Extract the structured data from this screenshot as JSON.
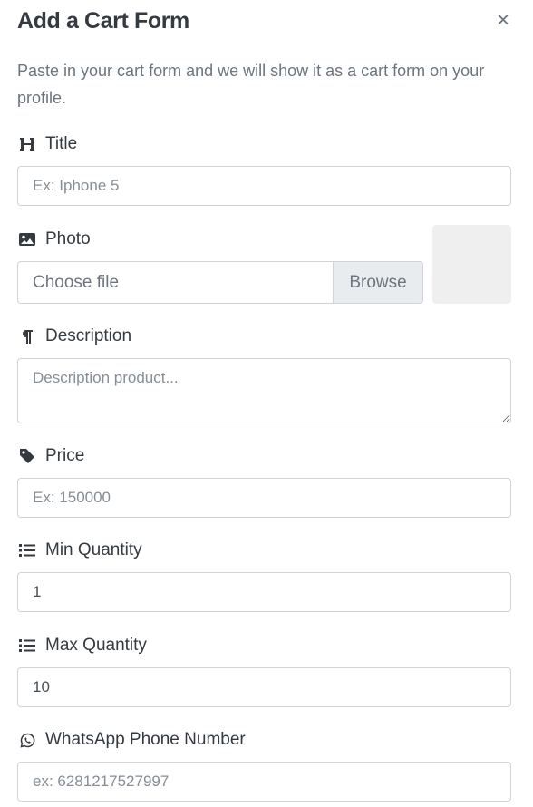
{
  "modal": {
    "title": "Add a Cart Form",
    "close_glyph": "×",
    "description": "Paste in your cart form and we will show it as a cart form on your profile."
  },
  "fields": {
    "title": {
      "label": "Title",
      "icon": "heading-icon",
      "placeholder": "Ex: Iphone 5"
    },
    "photo": {
      "label": "Photo",
      "icon": "image-icon",
      "file_text": "Choose file",
      "browse_label": "Browse"
    },
    "description": {
      "label": "Description",
      "icon": "paragraph-icon",
      "placeholder": "Description product..."
    },
    "price": {
      "label": "Price",
      "icon": "tag-icon",
      "placeholder": "Ex: 150000"
    },
    "min_quantity": {
      "label": "Min Quantity",
      "icon": "list-icon",
      "value": "1"
    },
    "max_quantity": {
      "label": "Max Quantity",
      "icon": "list-icon",
      "value": "10"
    },
    "whatsapp": {
      "label": "WhatsApp Phone Number",
      "icon": "whatsapp-icon",
      "placeholder": "ex: 6281217527997"
    }
  }
}
